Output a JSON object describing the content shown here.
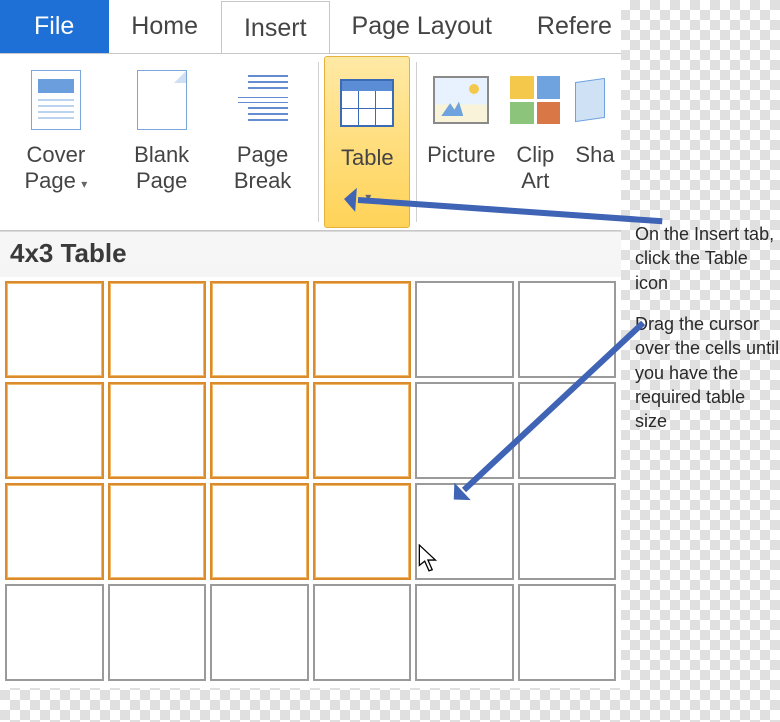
{
  "tabs": {
    "file": "File",
    "home": "Home",
    "insert": "Insert",
    "page_layout": "Page Layout",
    "references": "Refere"
  },
  "ribbon": {
    "cover_page": "Cover Page",
    "blank_page": "Blank Page",
    "page_break": "Page Break",
    "table": "Table",
    "picture": "Picture",
    "clip_art": "Clip Art",
    "shapes": "Sha"
  },
  "picker": {
    "title": "4x3 Table",
    "rows_selected": 3,
    "cols_selected": 4,
    "rows_total": 4,
    "cols_total": 6
  },
  "annotations": {
    "a1": "On the Insert tab, click the Table icon",
    "a2": "Drag the cursor over the cells until you have the required table size"
  },
  "colors": {
    "accent": "#1e6fd6",
    "highlight": "#ffd358",
    "arrow": "#3f63b5"
  }
}
